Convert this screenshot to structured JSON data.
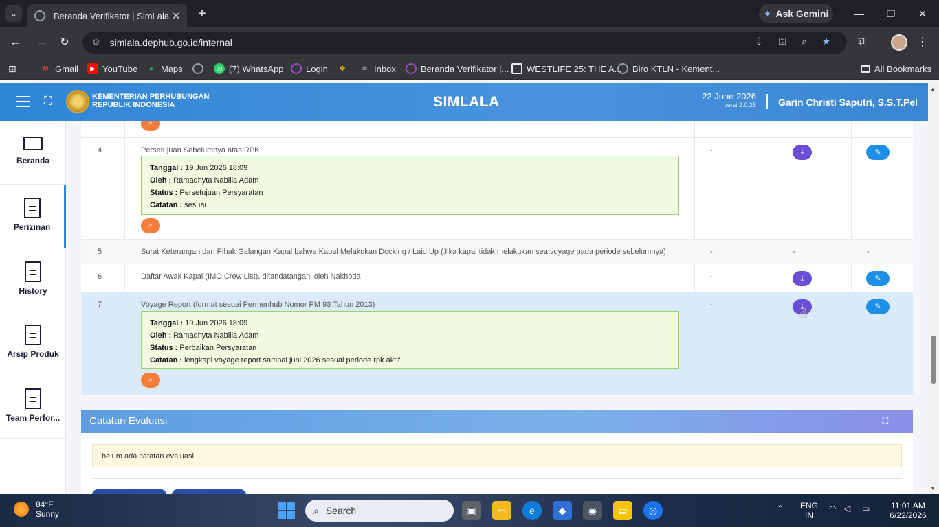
{
  "browser": {
    "tab_title": "Beranda Verifikator | SimLala",
    "url": "simlala.dephub.go.id/internal",
    "gemini_label": "Ask Gemini",
    "bookmarks": [
      {
        "label": "Gmail",
        "icon": "gmail-icon",
        "color": "#ea4335"
      },
      {
        "label": "YouTube",
        "icon": "youtube-icon",
        "color": "#ff0000"
      },
      {
        "label": "Maps",
        "icon": "maps-icon",
        "color": "#34a853"
      },
      {
        "label": "",
        "icon": "globe-icon",
        "color": "#9aa0a6"
      },
      {
        "label": "(7) WhatsApp",
        "icon": "whatsapp-icon",
        "color": "#25d366",
        "badge": "29"
      },
      {
        "label": "Login",
        "icon": "login-icon",
        "color": "#9c4dcc"
      },
      {
        "label": "",
        "icon": "pinwheel-icon",
        "color": "#fbbc05"
      },
      {
        "label": "Inbox",
        "icon": "mail-icon",
        "color": "#9aa0a6"
      },
      {
        "label": "Beranda Verifikator |...",
        "icon": "simlala-icon",
        "color": "#9c4dcc"
      },
      {
        "label": "WESTLIFE 25: THE A...",
        "icon": "westlife-icon",
        "color": "#e8eaed"
      },
      {
        "label": "Biro KTLN - Kement...",
        "icon": "globe-icon",
        "color": "#9aa0a6"
      }
    ],
    "all_bookmarks_label": "All Bookmarks"
  },
  "app": {
    "ministry_line1": "KEMENTERIAN PERHUBUNGAN",
    "ministry_line2": "REPUBLIK INDONESIA",
    "title": "SIMLALA",
    "date": "22 June 2026",
    "version": "versi 2.0.25",
    "user": "Garin Christi Saputri, S.S.T.Pel"
  },
  "sidebar": {
    "items": [
      {
        "label": "Beranda",
        "icon": "monitor-icon"
      },
      {
        "label": "Perizinan",
        "icon": "document-icon"
      },
      {
        "label": "History",
        "icon": "document-icon"
      },
      {
        "label": "Arsip Produk",
        "icon": "document-icon"
      },
      {
        "label": "Team Perfor...",
        "icon": "document-icon"
      }
    ]
  },
  "table": {
    "rows": [
      {
        "no": "4",
        "title": "Persetujuan Sebelumnya atas RPK",
        "note": {
          "tanggal": "19 Jun 2026 18:09",
          "oleh": "Ramadhyta Nabilla Adam",
          "status": "Persetujuan Persyaratan",
          "catatan": "sesuai"
        },
        "value": "-"
      },
      {
        "no": "5",
        "title": "Surat Keterangan dari Pihak Galangan Kapal bahwa Kapal Melakukan Docking / Laid Up (Jika kapal tidak melakukan sea voyage pada periode sebelumnya)",
        "value": "-",
        "download": "-",
        "edit": "-"
      },
      {
        "no": "6",
        "title": "Daftar Awak Kapal (IMO Crew List), ditandatangani oleh Nakhoda",
        "value": "-"
      },
      {
        "no": "7",
        "title": "Voyage Report (format sesuai Permenhub Nomor PM 93 Tahun 2013)",
        "note": {
          "tanggal": "19 Jun 2026 18:09",
          "oleh": "Ramadhyta Nabilla Adam",
          "status": "Perbaikan Persyaratan",
          "catatan": "lengkapi voyage report sampai juni 2026 sesuai periode rpk aktif"
        },
        "value": "-"
      }
    ],
    "labels": {
      "tanggal": "Tanggal :",
      "oleh": "Oleh :",
      "status": "Status :",
      "catatan": "Catatan :"
    }
  },
  "evaluation": {
    "title": "Catatan Evaluasi",
    "note": "belum ada catatan evaluasi"
  },
  "taskbar": {
    "temperature": "84°F",
    "condition": "Sunny",
    "search_placeholder": "Search",
    "lang1": "ENG",
    "lang2": "IN",
    "time": "11:01 AM",
    "date": "6/22/2026"
  },
  "colors": {
    "header_blue": "#2f86d6",
    "download_purple": "#6a4fd6",
    "edit_blue": "#1d8fe6",
    "zoom_orange": "#f47e3a",
    "note_green_bg": "#f0fbe1"
  }
}
